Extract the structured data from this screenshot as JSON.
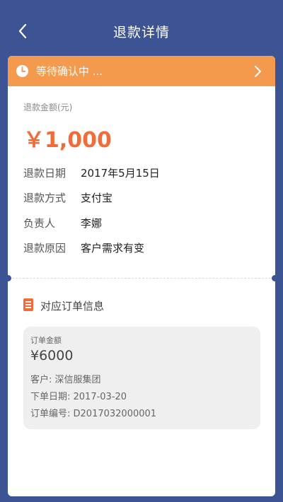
{
  "nav": {
    "title": "退款详情",
    "back_icon": "chevron-left-icon"
  },
  "status": {
    "text": "等待确认中 ...",
    "icon": "clock-icon",
    "color": "#f39a4e"
  },
  "refund": {
    "amount_label": "退款金额(元)",
    "amount": "￥1,000",
    "amount_color": "#f26c3a",
    "rows": [
      {
        "key": "退款日期",
        "value": "2017年5月15日"
      },
      {
        "key": "退款方式",
        "value": "支付宝"
      },
      {
        "key": "负责人",
        "value": "李娜"
      },
      {
        "key": "退款原因",
        "value": "客户需求有变"
      }
    ]
  },
  "order_section": {
    "title": "对应订单信息",
    "icon": "list-icon",
    "card": {
      "amount_label": "订单金额",
      "amount": "¥6000",
      "customer": "客户: 深信服集团",
      "date": "下单日期: 2017-03-20",
      "number": "订单编号: D2017032000001"
    }
  },
  "theme": {
    "background": "#3d5494"
  }
}
